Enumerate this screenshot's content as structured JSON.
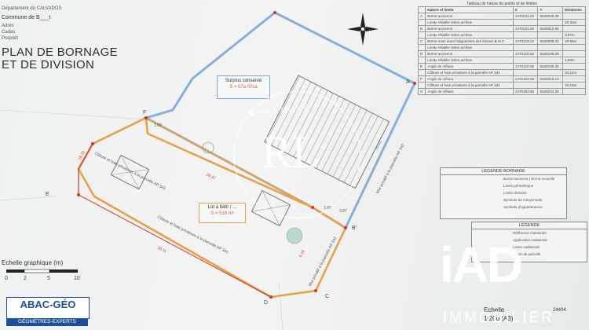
{
  "header": {
    "department": "Département du CALVADOS",
    "commune": "Commune de B___t",
    "adresse": "Adres",
    "cadastre": "Cadas",
    "proprietaire": "Propriét",
    "title_line1": "PLAN DE BORNAGE",
    "title_line2": "ET DE DIVISION"
  },
  "points_table": {
    "title": "Tableau de nature de points et de limites",
    "columns": [
      "",
      "Nature et limite",
      "X",
      "Y",
      "Distances"
    ],
    "rows": [
      [
        "A",
        "Borne ancienne",
        "1470231.22",
        "8230030.40",
        ""
      ],
      [
        "",
        "Limite rétablie selon archive",
        "",
        "",
        "20.43m"
      ],
      [
        "B",
        "Borne ancienne",
        "1470221.00",
        "8230012.68",
        ""
      ],
      [
        "",
        "Limite rétablie selon archive",
        "",
        "",
        "3.87m"
      ],
      [
        "C",
        "Borne mise dans l'alignement des bornes B et C",
        "1470219.12",
        "8230009.41",
        "19.65m"
      ],
      [
        "",
        "Limite rétablie selon archive",
        "",
        "",
        ""
      ],
      [
        "D",
        "Borne ancienne",
        "1470210.60",
        "8230196.29",
        ""
      ],
      [
        "",
        "Limite rétablie selon archive",
        "",
        "",
        "1.50m"
      ],
      [
        "E",
        "Angle de clôture",
        "1470210.05",
        "8230195.40",
        ""
      ],
      [
        "",
        "Clôture et haie privatives à la parcelle AP 341",
        "",
        "",
        "33.11m"
      ],
      [
        "F",
        "Angle de clôture",
        "1470182.05",
        "8230213.13",
        ""
      ],
      [
        "",
        "Clôture et haie privatives à la parcelle AP 341",
        "",
        "",
        "16.10m"
      ],
      [
        "G",
        "Angle de clôture",
        "1470182.65",
        "8230224.36",
        ""
      ]
    ]
  },
  "plan": {
    "surplus_label": "Surplus conservé",
    "surplus_area": "S = 07a 07ca",
    "lot_label": "Lot à bâtir / ... ",
    "lot_area": "S = 518 m²",
    "dist_top": "28.37",
    "dist_right": "20.43",
    "dist_left": "16.10",
    "dist_bottom": "33.11",
    "dist_small": "1.00",
    "dist_small2": "3.87",
    "dist_side": "5.18",
    "point_labels": [
      "F",
      "E",
      "D",
      "C",
      "B'",
      "A",
      "B"
    ],
    "fence_text1": "Clôture et haie privatives à la parcelle AP 341",
    "fence_text2": "Clôture et haie privatives à la parcelle AP 341",
    "road_text": "Mur privatif à la parcelle AP 342",
    "road_text2": "Mur privatif à la parcelle AP 342"
  },
  "legend_bornage": {
    "title": "LEGENDE BORNAGE",
    "items": [
      "Borne ancienne | Borne nouvelle",
      "Limite périmétrique",
      "Limite divisaire",
      "Symbole de mitoyenneté",
      "Symbole d'appartenance"
    ]
  },
  "legende": {
    "title": "LEGENDE",
    "items": [
      "Référence cadastrale",
      "Application cadastrale",
      "Limite cadastrale",
      "Limite de parcelle"
    ]
  },
  "scale": {
    "label": "Echelle graphique (m)",
    "ticks": [
      "0",
      "2",
      "5",
      "10"
    ],
    "echelle_label": "Echelle",
    "echelle_value": "1/200 (A3)",
    "ref": "24404"
  },
  "logo": {
    "name": "ABAC-GÉO",
    "sub": "GÉOMÈTRES-EXPERTS"
  },
  "watermarks": {
    "rl": "RL",
    "ring": "ROMAIN LEJOLIE",
    "iad": "iAD",
    "iad_sub": "IMMOBILIER"
  },
  "colors": {
    "perimeter": "#7aa7d8",
    "division": "#e6a24a",
    "red_mark": "#d0342c"
  }
}
